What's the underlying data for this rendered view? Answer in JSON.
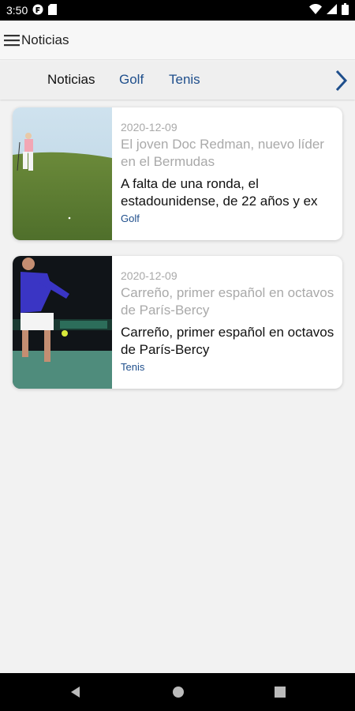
{
  "status": {
    "time": "3:50"
  },
  "appbar": {
    "title": "Noticias"
  },
  "tabs": [
    {
      "label": "Noticias",
      "active": true
    },
    {
      "label": "Golf",
      "active": false
    },
    {
      "label": "Tenis",
      "active": false
    }
  ],
  "articles": [
    {
      "date": "2020-12-09",
      "title": "El joven Doc Redman, nuevo líder en el Bermudas",
      "summary": "A falta de una ronda, el estadounidense, de 22 años y ex",
      "tag": "Golf",
      "image": "golf-player-photo"
    },
    {
      "date": "2020-12-09",
      "title": "Carreño, primer español en octavos de París-Bercy",
      "summary": "Carreño, primer español en octavos de París-Bercy",
      "tag": "Tenis",
      "image": "tennis-player-photo"
    }
  ],
  "colors": {
    "accent": "#1f4f8c",
    "muted": "#a9a9a9",
    "background": "#f2f2f2"
  }
}
